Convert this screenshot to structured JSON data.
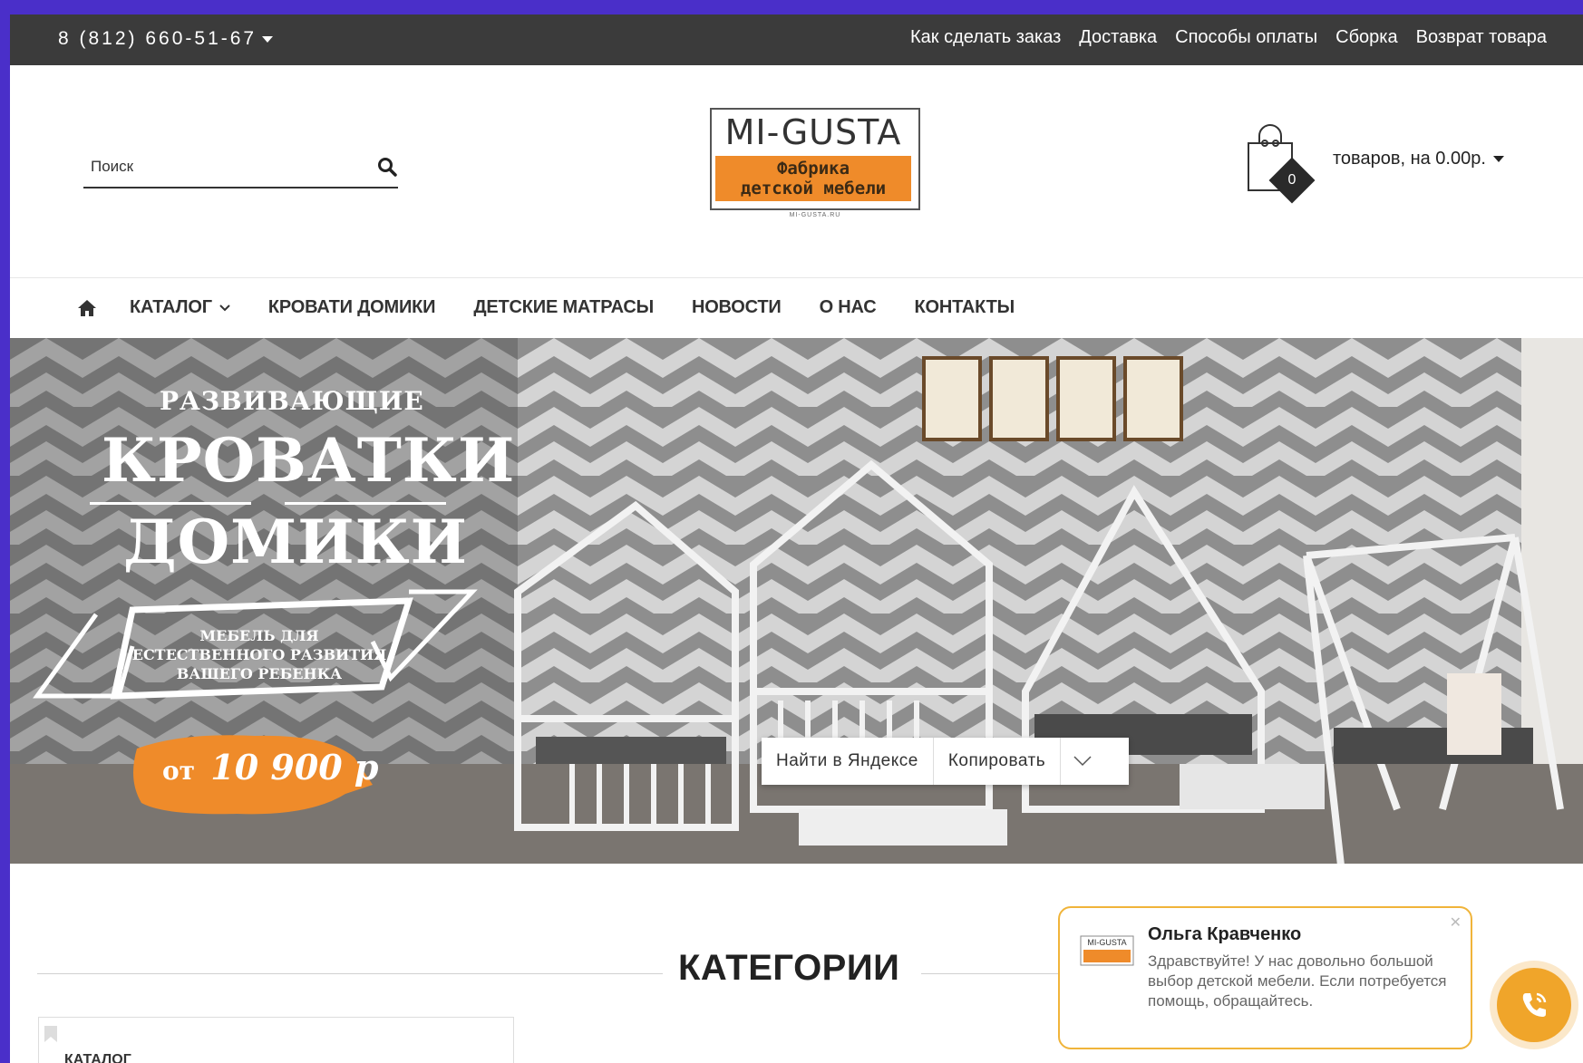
{
  "topbar": {
    "phone": "8 (812) 660-51-67",
    "links": [
      "Как сделать заказ",
      "Доставка",
      "Способы оплаты",
      "Сборка",
      "Возврат товара"
    ]
  },
  "header": {
    "search_placeholder": "Поиск",
    "logo": {
      "brand": "MI-GUSTA",
      "line1": "Фабрика",
      "line2": "детской мебели",
      "url": "MI-GUSTA.RU"
    },
    "cart": {
      "count": "0",
      "text": "товаров, на 0.00р."
    }
  },
  "nav": {
    "items": [
      "КАТАЛОГ",
      "КРОВАТИ ДОМИКИ",
      "ДЕТСКИЕ МАТРАСЫ",
      "НОВОСТИ",
      "О НАС",
      "КОНТАКТЫ"
    ]
  },
  "banner": {
    "subtitle": "РАЗВИВАЮЩИЕ",
    "title1": "КРОВАТКИ",
    "title2": "ДОМИКИ",
    "ribbon_line1": "МЕБЕЛЬ ДЛЯ",
    "ribbon_line2": "ЕСТЕСТВЕННОГО РАЗВИТИЯ",
    "ribbon_line3": "ВАШЕГО РЕБЕНКА",
    "price_prefix": "от",
    "price": "10 900 р"
  },
  "context_menu": {
    "find": "Найти в Яндексе",
    "copy": "Копировать"
  },
  "categories": {
    "title": "КАТЕГОРИИ",
    "first_card": "КАТАЛОГ"
  },
  "chat": {
    "name": "Ольга Кравченко",
    "message": "Здравствуйте! У нас довольно большой выбор детской мебели. Если потребуется помощь, обращайтесь."
  },
  "colors": {
    "topbar": "#3b3b3b",
    "accent": "#ef8b2a",
    "chat_border": "#f0b43a",
    "frame": "#4a2fc9"
  }
}
